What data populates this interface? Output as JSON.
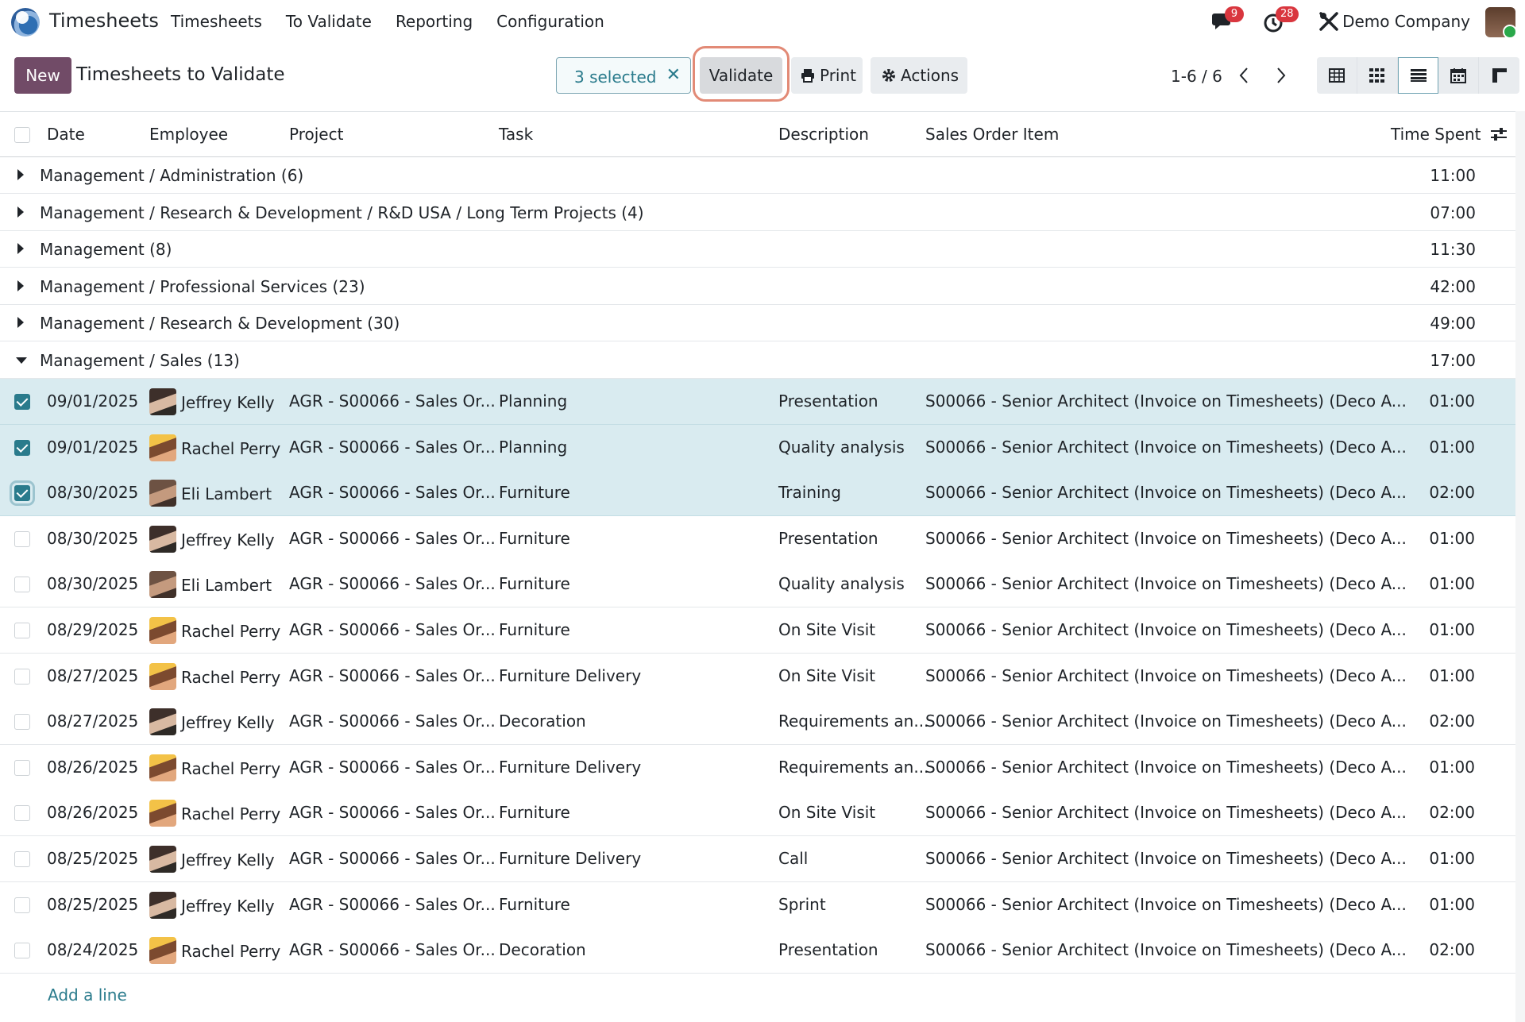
{
  "navbar": {
    "app_name": "Timesheets",
    "menu": [
      "Timesheets",
      "To Validate",
      "Reporting",
      "Configuration"
    ],
    "messages_badge": "9",
    "activities_badge": "28",
    "company": "Demo Company",
    "icons": [
      "odoo-logo-icon",
      "chat-icon",
      "clock-icon",
      "tools-icon",
      "user-avatar"
    ]
  },
  "control": {
    "new_label": "New",
    "title": "Timesheets to Validate",
    "selected_label": "3 selected",
    "clear_symbol": "✕",
    "validate_label": "Validate",
    "print_label": "Print",
    "actions_label": "Actions",
    "pager": "1-6 / 6",
    "views": [
      "grid",
      "kanban",
      "list",
      "calendar",
      "pivot"
    ],
    "active_view": "list"
  },
  "list": {
    "headers": {
      "date": "Date",
      "employee": "Employee",
      "project": "Project",
      "task": "Task",
      "description": "Description",
      "sales_order_item": "Sales Order Item",
      "time_spent": "Time Spent"
    },
    "groups": [
      {
        "name": "Management / Administration (6)",
        "total": "11:00",
        "open": false
      },
      {
        "name": "Management / Research & Development / R&D USA / Long Term Projects (4)",
        "total": "07:00",
        "open": false
      },
      {
        "name": "Management (8)",
        "total": "11:30",
        "open": false
      },
      {
        "name": "Management / Professional Services (23)",
        "total": "42:00",
        "open": false
      },
      {
        "name": "Management / Research & Development (30)",
        "total": "49:00",
        "open": false
      },
      {
        "name": "Management / Sales (13)",
        "total": "17:00",
        "open": true
      }
    ],
    "records": [
      {
        "date": "09/01/2025",
        "employee": "Jeffrey Kelly",
        "av": "jk",
        "project": "AGR - S00066 - Sales Or...",
        "task": "Planning",
        "description": "Presentation",
        "so_item": "S00066 - Senior Architect (Invoice on Timesheets) (Deco A...",
        "time": "01:00",
        "selected": true
      },
      {
        "date": "09/01/2025",
        "employee": "Rachel Perry",
        "av": "rp",
        "project": "AGR - S00066 - Sales Or...",
        "task": "Planning",
        "description": "Quality analysis",
        "so_item": "S00066 - Senior Architect (Invoice on Timesheets) (Deco A...",
        "time": "01:00",
        "selected": true
      },
      {
        "date": "08/30/2025",
        "employee": "Eli Lambert",
        "av": "el",
        "project": "AGR - S00066 - Sales Or...",
        "task": "Furniture",
        "description": "Training",
        "so_item": "S00066 - Senior Architect (Invoice on Timesheets) (Deco A...",
        "time": "02:00",
        "selected": true
      },
      {
        "date": "08/30/2025",
        "employee": "Jeffrey Kelly",
        "av": "jk",
        "project": "AGR - S00066 - Sales Or...",
        "task": "Furniture",
        "description": "Presentation",
        "so_item": "S00066 - Senior Architect (Invoice on Timesheets) (Deco A...",
        "time": "01:00",
        "selected": false
      },
      {
        "date": "08/30/2025",
        "employee": "Eli Lambert",
        "av": "el",
        "project": "AGR - S00066 - Sales Or...",
        "task": "Furniture",
        "description": "Quality analysis",
        "so_item": "S00066 - Senior Architect (Invoice on Timesheets) (Deco A...",
        "time": "01:00",
        "selected": false
      },
      {
        "date": "08/29/2025",
        "employee": "Rachel Perry",
        "av": "rp",
        "project": "AGR - S00066 - Sales Or...",
        "task": "Furniture",
        "description": "On Site Visit",
        "so_item": "S00066 - Senior Architect (Invoice on Timesheets) (Deco A...",
        "time": "01:00",
        "selected": false
      },
      {
        "date": "08/27/2025",
        "employee": "Rachel Perry",
        "av": "rp",
        "project": "AGR - S00066 - Sales Or...",
        "task": "Furniture Delivery",
        "description": "On Site Visit",
        "so_item": "S00066 - Senior Architect (Invoice on Timesheets) (Deco A...",
        "time": "01:00",
        "selected": false
      },
      {
        "date": "08/27/2025",
        "employee": "Jeffrey Kelly",
        "av": "jk",
        "project": "AGR - S00066 - Sales Or...",
        "task": "Decoration",
        "description": "Requirements an...",
        "so_item": "S00066 - Senior Architect (Invoice on Timesheets) (Deco A...",
        "time": "02:00",
        "selected": false
      },
      {
        "date": "08/26/2025",
        "employee": "Rachel Perry",
        "av": "rp",
        "project": "AGR - S00066 - Sales Or...",
        "task": "Furniture Delivery",
        "description": "Requirements an...",
        "so_item": "S00066 - Senior Architect (Invoice on Timesheets) (Deco A...",
        "time": "01:00",
        "selected": false
      },
      {
        "date": "08/26/2025",
        "employee": "Rachel Perry",
        "av": "rp",
        "project": "AGR - S00066 - Sales Or...",
        "task": "Furniture",
        "description": "On Site Visit",
        "so_item": "S00066 - Senior Architect (Invoice on Timesheets) (Deco A...",
        "time": "02:00",
        "selected": false
      },
      {
        "date": "08/25/2025",
        "employee": "Jeffrey Kelly",
        "av": "jk",
        "project": "AGR - S00066 - Sales Or...",
        "task": "Furniture Delivery",
        "description": "Call",
        "so_item": "S00066 - Senior Architect (Invoice on Timesheets) (Deco A...",
        "time": "01:00",
        "selected": false
      },
      {
        "date": "08/25/2025",
        "employee": "Jeffrey Kelly",
        "av": "jk",
        "project": "AGR - S00066 - Sales Or...",
        "task": "Furniture",
        "description": "Sprint",
        "so_item": "S00066 - Senior Architect (Invoice on Timesheets) (Deco A...",
        "time": "01:00",
        "selected": false
      },
      {
        "date": "08/24/2025",
        "employee": "Rachel Perry",
        "av": "rp",
        "project": "AGR - S00066 - Sales Or...",
        "task": "Decoration",
        "description": "Presentation",
        "so_item": "S00066 - Senior Architect (Invoice on Timesheets) (Deco A...",
        "time": "02:00",
        "selected": false
      }
    ],
    "add_line": "Add a line"
  },
  "colors": {
    "brand": "#714b67",
    "accent": "#2a7b8c",
    "selected_row": "#d9ebf0",
    "badge": "#d9363e",
    "validate_highlight": "#e28a76"
  }
}
